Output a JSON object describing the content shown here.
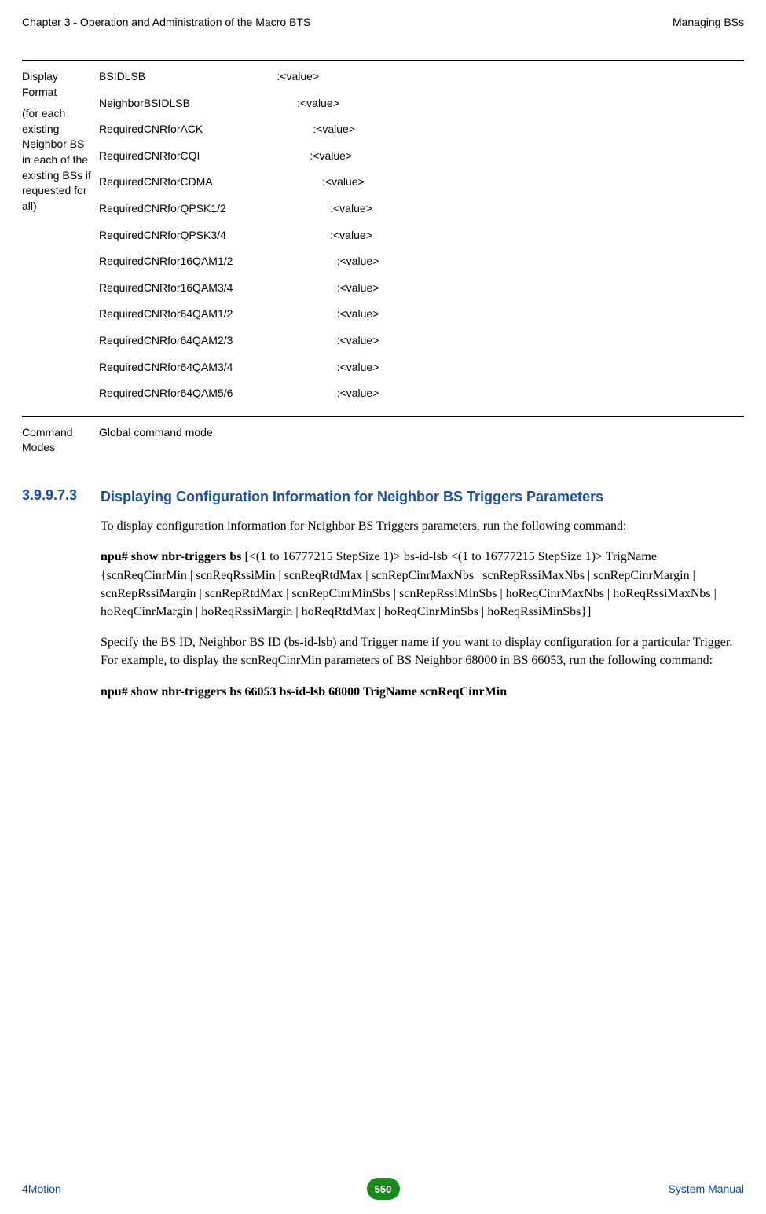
{
  "header": {
    "left": "Chapter 3 - Operation and Administration of the Macro BTS",
    "right": "Managing BSs"
  },
  "displayFormat": {
    "label": "Display Format",
    "subLabel": "(for each existing Neighbor BS in each of the existing BSs if requested for all)",
    "rows": [
      {
        "key": "BSIDLSB                                           :",
        "val": "<value>"
      },
      {
        "key": "NeighborBSIDLSB                                   :",
        "val": "<value>"
      },
      {
        "key": "RequiredCNRforACK                                    :",
        "val": "<value>"
      },
      {
        "key": "RequiredCNRforCQI                                    :",
        "val": "<value>"
      },
      {
        "key": "RequiredCNRforCDMA                                    :",
        "val": "<value>"
      },
      {
        "key": "RequiredCNRforQPSK1/2                                  :",
        "val": "<value>"
      },
      {
        "key": "RequiredCNRforQPSK3/4                                  :",
        "val": "<value>"
      },
      {
        "key": "RequiredCNRfor16QAM1/2                                  :",
        "val": "<value>"
      },
      {
        "key": "RequiredCNRfor16QAM3/4                                  :",
        "val": "<value>"
      },
      {
        "key": "RequiredCNRfor64QAM1/2                                  :",
        "val": "<value>"
      },
      {
        "key": "RequiredCNRfor64QAM2/3                                  :",
        "val": "<value>"
      },
      {
        "key": "RequiredCNRfor64QAM3/4                                  :",
        "val": "<value>"
      },
      {
        "key": "RequiredCNRfor64QAM5/6                                  :",
        "val": "<value>"
      }
    ]
  },
  "commandModes": {
    "label": "Command Modes",
    "value": "Global command mode"
  },
  "heading": {
    "num": "3.9.9.7.3",
    "title": "Displaying Configuration Information for Neighbor BS Triggers Parameters"
  },
  "paragraphs": {
    "intro": "To display configuration information for Neighbor BS Triggers parameters, run the following command:",
    "cmd1_bold": "npu# show nbr-triggers bs",
    "cmd1_rest": " [<(1 to 16777215 StepSize 1)> bs-id-lsb <(1 to 16777215 StepSize 1)> TrigName {scnReqCinrMin | scnReqRssiMin | scnReqRtdMax | scnRepCinrMaxNbs | scnRepRssiMaxNbs | scnRepCinrMargin | scnRepRssiMargin | scnRepRtdMax | scnRepCinrMinSbs | scnRepRssiMinSbs | hoReqCinrMaxNbs | hoReqRssiMaxNbs | hoReqCinrMargin | hoReqRssiMargin | hoReqRtdMax | hoReqCinrMinSbs | hoReqRssiMinSbs}]",
    "specify": "Specify the BS ID, Neighbor BS ID (bs-id-lsb) and Trigger name if you want to display configuration for a particular Trigger. For example, to display the scnReqCinrMin parameters of BS Neighbor 68000 in BS 66053, run the following command:",
    "cmd2": "npu# show nbr-triggers bs 66053 bs-id-lsb 68000 TrigName scnReqCinrMin"
  },
  "footer": {
    "product": "4Motion",
    "page": "550",
    "manual": "System Manual"
  }
}
